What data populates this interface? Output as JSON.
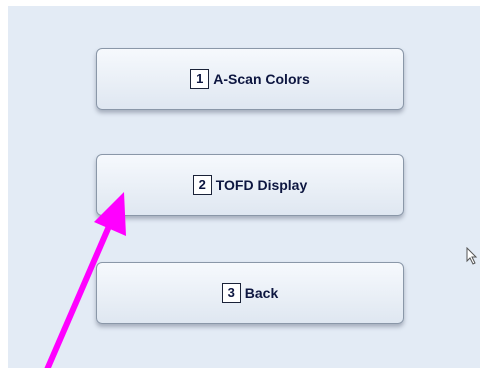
{
  "menu": {
    "buttons": [
      {
        "key": "1",
        "label": "A-Scan Colors"
      },
      {
        "key": "2",
        "label": "TOFD Display"
      },
      {
        "key": "3",
        "label": "Back"
      }
    ]
  },
  "colors": {
    "background": "#e3ebf5",
    "button_text": "#0d1640",
    "annotation_arrow": "#ff00ff"
  },
  "icons": {
    "pointer": "mouse-pointer-icon",
    "annotation": "annotation-arrow"
  }
}
